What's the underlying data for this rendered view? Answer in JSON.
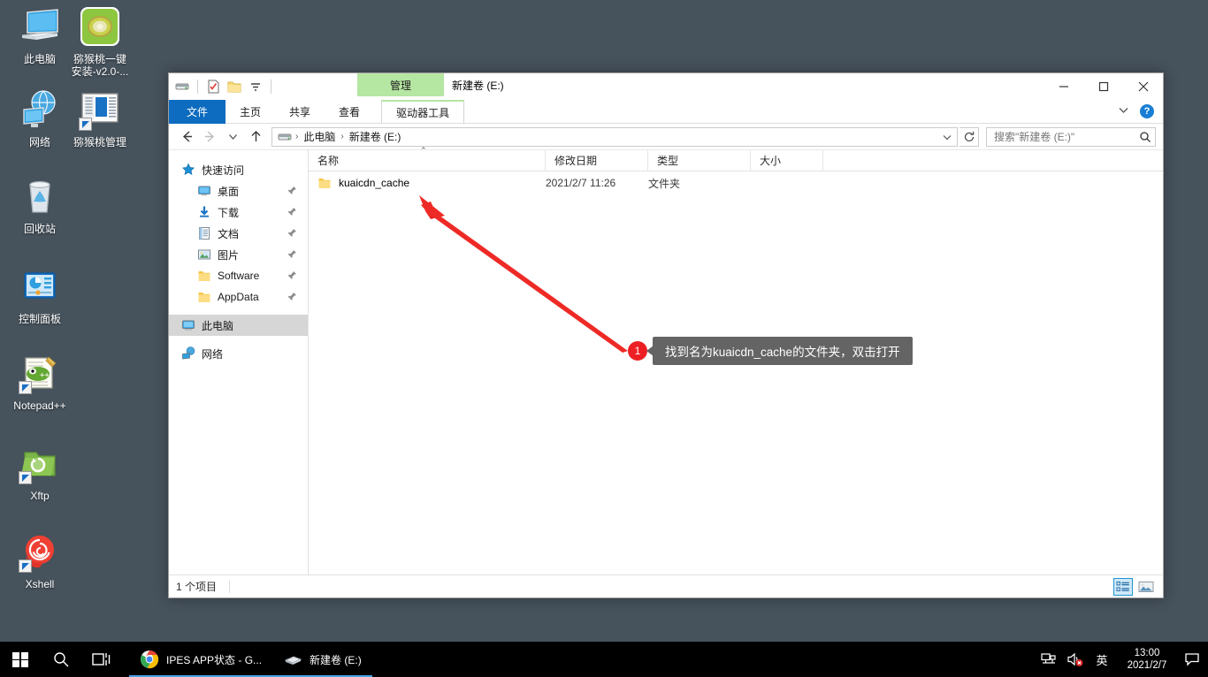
{
  "desktop": {
    "icons": [
      {
        "label": "此电脑",
        "icon": "this-pc-icon"
      },
      {
        "label": "猕猴桃一键\n安装-v2.0-...",
        "icon": "kiwi-installer-icon"
      },
      {
        "label": "网络",
        "icon": "network-icon"
      },
      {
        "label": "猕猴桃管理",
        "icon": "kiwi-manager-icon"
      },
      {
        "label": "回收站",
        "icon": "recycle-bin-icon"
      },
      {
        "label": "控制面板",
        "icon": "control-panel-icon"
      },
      {
        "label": "Notepad++",
        "icon": "notepad-plus-plus-icon"
      },
      {
        "label": "Xftp",
        "icon": "xftp-icon"
      },
      {
        "label": "Xshell",
        "icon": "xshell-icon"
      }
    ]
  },
  "explorer": {
    "window_title": "新建卷 (E:)",
    "contextual_tab_group": "管理",
    "quick_access_toolbar": [
      {
        "name": "drive-properties-icon"
      },
      {
        "name": "properties-icon"
      },
      {
        "name": "new-folder-icon"
      },
      {
        "name": "customize-dropdown-icon"
      }
    ],
    "tabs": [
      {
        "label": "文件",
        "active": true
      },
      {
        "label": "主页",
        "active": false
      },
      {
        "label": "共享",
        "active": false
      },
      {
        "label": "查看",
        "active": false
      },
      {
        "label": "驱动器工具",
        "active": false
      }
    ],
    "help_label": "?",
    "address": {
      "back_tooltip": "←",
      "forward_tooltip": "→",
      "recent_tooltip": "⌄",
      "up_tooltip": "↑",
      "breadcrumbs": [
        "此电脑",
        "新建卷 (E:)"
      ],
      "separator": "›"
    },
    "search": {
      "placeholder": "搜索\"新建卷 (E:)\""
    },
    "nav_pane": {
      "groups": [
        {
          "header": "快速访问",
          "icon": "star-icon",
          "items": [
            {
              "label": "桌面",
              "icon": "desktop-icon",
              "pinned": true
            },
            {
              "label": "下载",
              "icon": "downloads-icon",
              "pinned": true
            },
            {
              "label": "文档",
              "icon": "documents-icon",
              "pinned": true
            },
            {
              "label": "图片",
              "icon": "pictures-icon",
              "pinned": true
            },
            {
              "label": "Software",
              "icon": "folder-icon",
              "pinned": true
            },
            {
              "label": "AppData",
              "icon": "folder-icon",
              "pinned": true
            }
          ]
        },
        {
          "header": "此电脑",
          "icon": "this-pc-icon",
          "selected": true,
          "items": []
        },
        {
          "header": "网络",
          "icon": "network-icon",
          "items": []
        }
      ]
    },
    "columns": [
      {
        "label": "名称"
      },
      {
        "label": "修改日期"
      },
      {
        "label": "类型"
      },
      {
        "label": "大小"
      }
    ],
    "sort_indicator": "⌃",
    "rows": [
      {
        "name": "kuaicdn_cache",
        "modified": "2021/2/7 11:26",
        "type": "文件夹",
        "size": "",
        "icon": "folder-icon"
      }
    ],
    "status": {
      "item_count": "1 个项目"
    },
    "view_buttons": [
      {
        "name": "details-view-button",
        "active": true
      },
      {
        "name": "large-icons-view-button",
        "active": false
      }
    ]
  },
  "annotation": {
    "badge": "1",
    "text": "找到名为kuaicdn_cache的文件夹，双击打开",
    "arrow_color": "#ee2a26"
  },
  "taskbar": {
    "start_label": "start-button",
    "search_label": "search-button",
    "taskview_label": "task-view-button",
    "tasks": [
      {
        "label": "IPES APP状态 - G...",
        "icon": "chrome-icon",
        "active": true
      },
      {
        "label": "新建卷 (E:)",
        "icon": "drive-icon",
        "active": true
      }
    ],
    "tray": {
      "network_icon": "network-tray-icon",
      "volume_icon": "volume-muted-icon",
      "ime": "英",
      "time": "13:00",
      "date": "2021/2/7",
      "action_center_icon": "action-center-icon"
    }
  },
  "colors": {
    "desktop_bg": "#46525c",
    "accent_blue": "#0d6cbf",
    "ribbon_green": "#b5e6a2",
    "annotation_red": "#ec2024",
    "callout_gray": "#646464",
    "taskbar_black": "#000000"
  }
}
